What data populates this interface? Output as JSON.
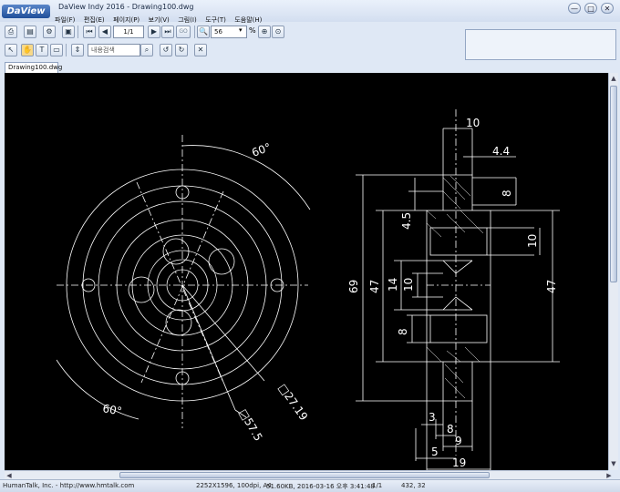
{
  "window": {
    "logo": "DaView",
    "title": "DaView Indy 2016 - Drawing100.dwg",
    "controls": {
      "minimize": "—",
      "restore": "□",
      "close": "✕"
    }
  },
  "menu": [
    "파일(F)",
    "편집(E)",
    "페이지(P)",
    "보기(V)",
    "그림(I)",
    "도구(T)",
    "도움말(H)"
  ],
  "toolbar": {
    "page_value": "1/1",
    "zoom_value": "56",
    "zoom_unit": "%",
    "search_placeholder": "내용검색",
    "go_label": "GO"
  },
  "document": {
    "tab_label": "Drawing100.dwg"
  },
  "drawing": {
    "dims": {
      "angle_top": "60°",
      "angle_bottom": "60°",
      "square_27": "□27.19",
      "square_57": "□57.5",
      "d10_top": "10",
      "d44": "4.4",
      "d8_right": "8",
      "d45": "4.5",
      "d10_right": "10",
      "d69": "69",
      "d47_left": "47",
      "d14": "14",
      "d10_mid": "10",
      "d47_right": "47",
      "d8_left": "8",
      "d3": "3",
      "d8_bottom": "8",
      "d9": "9",
      "d5": "5",
      "d19": "19"
    },
    "colors": {
      "background": "#000000",
      "lines": "#ffffff"
    }
  },
  "status": {
    "company": "HumanTalk, Inc. - http://www.hmtalk.com",
    "image_info": "2252X1596, 100dpi, A4",
    "file_info": "51.60KB, 2016-03-16 오후 3:41:48",
    "page": "1/1",
    "coords": "432, 32"
  }
}
